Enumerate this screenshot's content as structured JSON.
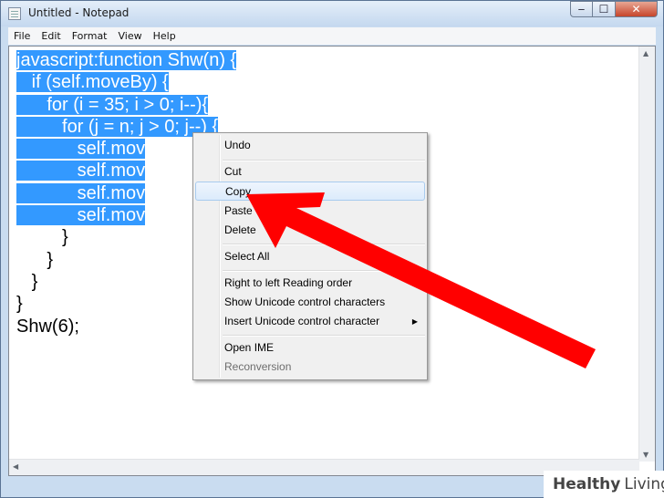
{
  "window": {
    "title": "Untitled - Notepad",
    "controls": {
      "minimize": "‒",
      "maximize": "☐",
      "close": "✕"
    }
  },
  "menubar": [
    "File",
    "Edit",
    "Format",
    "View",
    "Help"
  ],
  "editor": {
    "lines": [
      {
        "text": "javascript:function Shw(n) {",
        "selected": true
      },
      {
        "text": "   if (self.moveBy) {",
        "selected": true
      },
      {
        "text": "      for (i = 35; i > 0; i--){",
        "selected": true
      },
      {
        "text": "         for (j = n; j > 0; j--) {",
        "selected": true
      },
      {
        "text": "            self.mov",
        "selected": true
      },
      {
        "text": "            self.mov",
        "selected": true
      },
      {
        "text": "            self.mov",
        "selected": true
      },
      {
        "text": "            self.mov",
        "selected": true
      },
      {
        "text": "         }",
        "selected": false
      },
      {
        "text": "      }",
        "selected": false
      },
      {
        "text": "   }",
        "selected": false
      },
      {
        "text": "}",
        "selected": false
      },
      {
        "text": "Shw(6);",
        "selected": false
      }
    ]
  },
  "context_menu": {
    "items": [
      {
        "label": "Undo"
      },
      {
        "label": "Cut"
      },
      {
        "label": "Copy",
        "highlighted": true
      },
      {
        "label": "Paste"
      },
      {
        "label": "Delete"
      },
      {
        "label": "Select All"
      },
      {
        "label": "Right to left Reading order"
      },
      {
        "label": "Show Unicode control characters"
      },
      {
        "label": "Insert Unicode control character",
        "submenu": true
      },
      {
        "label": "Open IME"
      },
      {
        "label": "Reconversion",
        "disabled": true
      }
    ]
  },
  "annotation": {
    "arrow_color": "#ff0000"
  },
  "watermark": {
    "brand": "Healthy",
    "brand2": "Living"
  },
  "colors": {
    "selection": "#3399ff",
    "highlight_border": "#a8cbee"
  }
}
